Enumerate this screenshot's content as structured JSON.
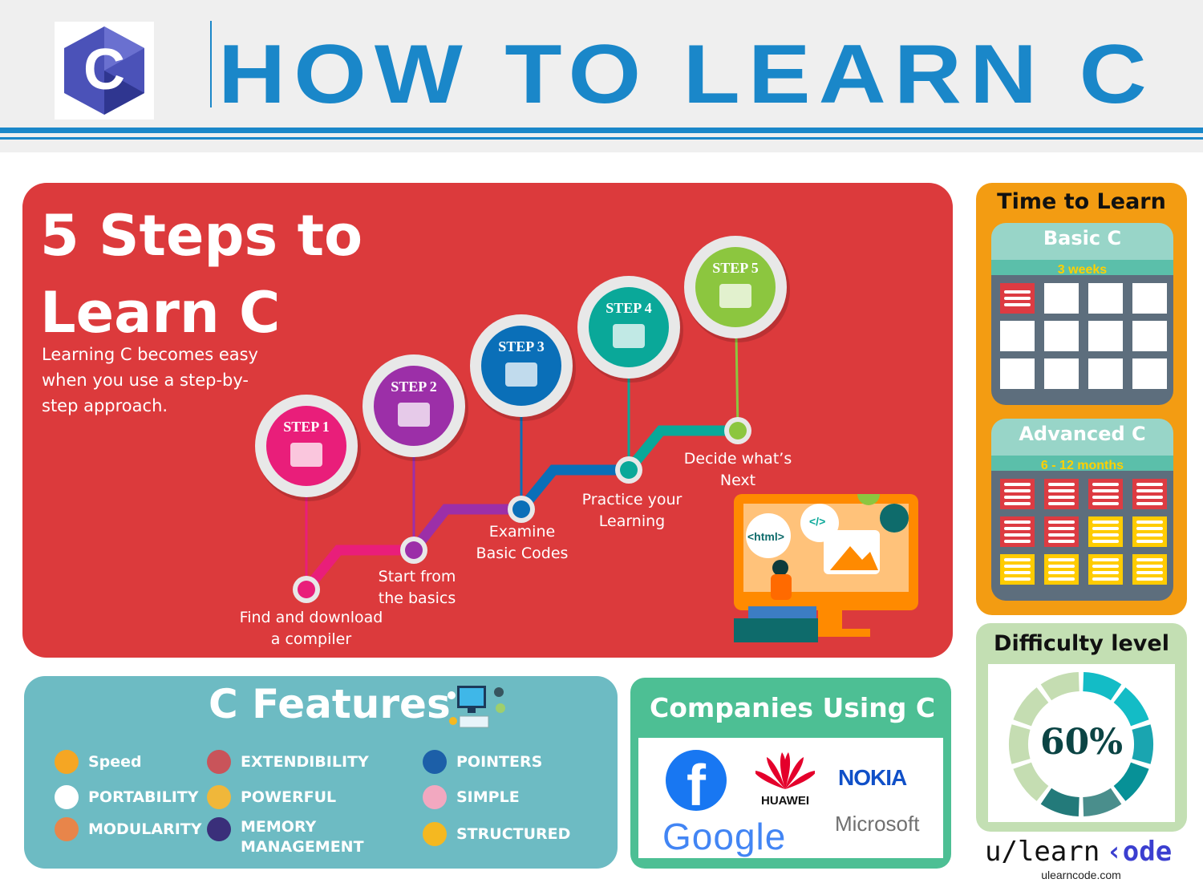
{
  "header": {
    "title": "HOW TO LEARN C",
    "logo_letter": "C",
    "accent": "#1a87c9"
  },
  "steps_panel": {
    "title": "5 Steps to Learn C",
    "description": "Learning C becomes easy when you use a step-by-step approach.",
    "steps": [
      {
        "badge": "STEP 1",
        "label_lines": [
          "Find and download",
          "a compiler"
        ],
        "color": "#e91e7a"
      },
      {
        "badge": "STEP 2",
        "label_lines": [
          "Start from",
          "the basics"
        ],
        "color": "#9c2fa8"
      },
      {
        "badge": "STEP 3",
        "label_lines": [
          "Examine",
          "Basic Codes"
        ],
        "color": "#0a6fb8"
      },
      {
        "badge": "STEP 4",
        "label_lines": [
          "Practice your",
          "Learning"
        ],
        "color": "#0aa899"
      },
      {
        "badge": "STEP 5",
        "label_lines": [
          "Decide what’s",
          "Next"
        ],
        "color": "#8cc63f"
      }
    ],
    "illustration": {
      "html_tag": "<html>",
      "code_tag": "</>"
    }
  },
  "time_to_learn": {
    "title": "Time to Learn",
    "levels": [
      {
        "name": "Basic C",
        "duration": "3 weeks",
        "cells_total": 12,
        "red_cells": 1,
        "yellow_cells": 0
      },
      {
        "name": "Advanced C",
        "duration": "6 - 12 months",
        "cells_total": 12,
        "red_cells": 6,
        "yellow_cells": 6
      }
    ]
  },
  "difficulty": {
    "title": "Difficulty level",
    "value_text": "60%",
    "percent": 60,
    "segments": 10,
    "filled_colors": [
      "#13bcc6",
      "#13bcc6",
      "#1aa5b0",
      "#079197",
      "#4a8e8c",
      "#237a7a"
    ],
    "empty_color": "#c5ddb2"
  },
  "features": {
    "title": "C Features",
    "items": [
      {
        "label": "Speed",
        "icon": "speed-chart-icon",
        "color": "#f5a623"
      },
      {
        "label": "PORTABILITY",
        "icon": "portability-icon",
        "color": "#ffffff"
      },
      {
        "label": "MODULARITY",
        "icon": "modularity-icon",
        "color": "#e8854a"
      },
      {
        "label": "EXTENDIBILITY",
        "icon": "thumbs-up-icon",
        "color": "#c9545a"
      },
      {
        "label": "POWERFUL",
        "icon": "shield-check-icon",
        "color": "#f0b73a"
      },
      {
        "label": "MEMORY MANAGEMENT",
        "icon": "memory-icon",
        "color": "#3a2f7a"
      },
      {
        "label": "POINTERS",
        "icon": "monitor-icon",
        "color": "#1c5fa8"
      },
      {
        "label": "SIMPLE",
        "icon": "checkbox-icon",
        "color": "#f2a8c0"
      },
      {
        "label": "STRUCTURED",
        "icon": "structured-icon",
        "color": "#f5b820"
      }
    ]
  },
  "companies": {
    "title": "Companies Using C",
    "logos": [
      "f",
      "HUAWEI",
      "NOKIA",
      "Google",
      "Microsoft"
    ]
  },
  "brand": {
    "logo_a": "u/learn",
    "logo_b": "‹ode",
    "url": "ulearncode.com"
  }
}
